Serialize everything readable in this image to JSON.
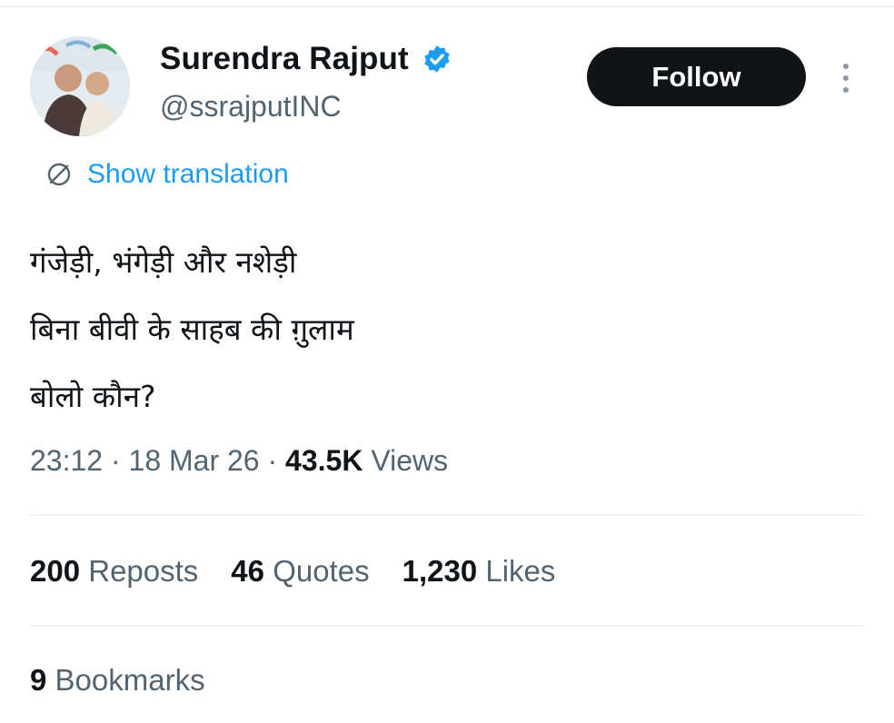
{
  "author": {
    "display_name": "Surendra Rajput",
    "handle": "@ssrajputINC",
    "verified": true
  },
  "actions": {
    "follow_label": "Follow"
  },
  "translation": {
    "label": "Show translation"
  },
  "tweet": {
    "lines": [
      "गंजेड़ी, भंगेड़ी और नशेड़ी",
      "बिना बीवी के साहब की ग़ुलाम",
      "बोलो कौन?"
    ]
  },
  "meta": {
    "time": "23:12",
    "date": "18 Mar 26",
    "separator": "·",
    "views_count": "43.5K",
    "views_label": "Views"
  },
  "stats": {
    "reposts_count": "200",
    "reposts_label": "Reposts",
    "quotes_count": "46",
    "quotes_label": "Quotes",
    "likes_count": "1,230",
    "likes_label": "Likes",
    "bookmarks_count": "9",
    "bookmarks_label": "Bookmarks"
  },
  "icons": {
    "verified": "verified-badge-icon",
    "translation": "translate-globe-icon",
    "more": "more-vertical-icon"
  },
  "colors": {
    "text_primary": "#0f1419",
    "text_secondary": "#536471",
    "link": "#1d9bf0",
    "follow_button_bg": "#0f1419",
    "divider": "#eff3f4"
  }
}
